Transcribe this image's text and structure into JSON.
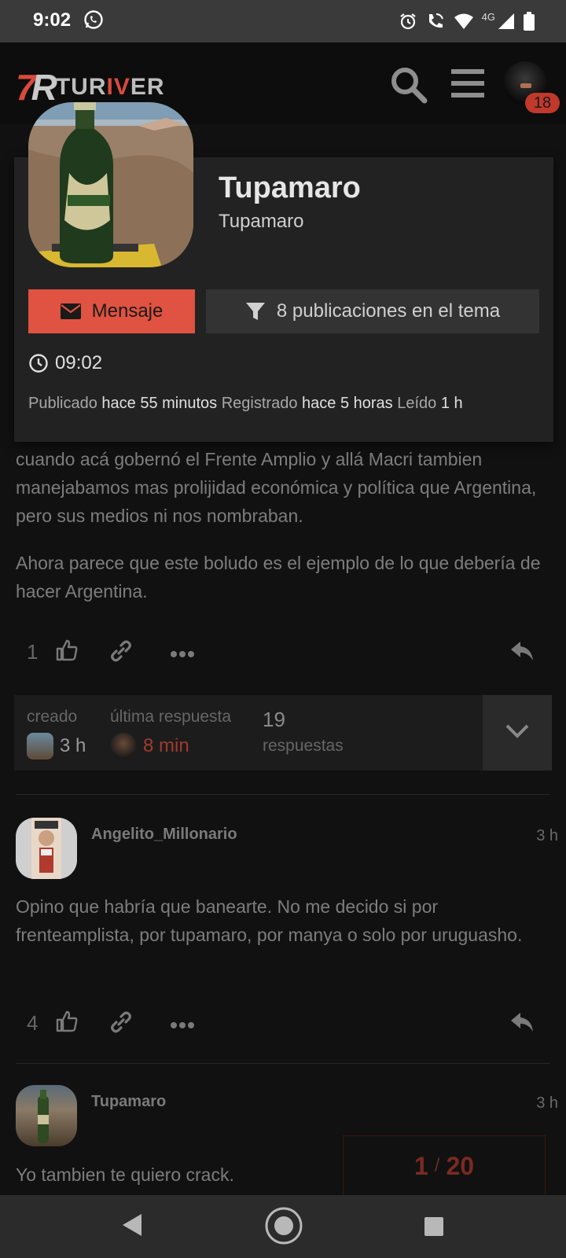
{
  "status_bar": {
    "time": "9:02",
    "network": "4G"
  },
  "header": {
    "logo_mark_a": "7",
    "logo_mark_b": "R",
    "logo_word_a": "TUR",
    "logo_word_b": "IV",
    "logo_word_c": "ER",
    "notification_count": "18"
  },
  "user_card": {
    "name": "Tupamaro",
    "username": "Tupamaro",
    "message_button": "Mensaje",
    "filter_button": "8 publicaciones en el tema",
    "local_time": "09:02",
    "posted_label": "Publicado",
    "posted_value": "hace 55 minutos",
    "registered_label": "Registrado",
    "registered_value": "hace 5 horas",
    "read_label": "Leído",
    "read_value": "1 h"
  },
  "post1": {
    "paragraph1": "cuando acá gobernó el Frente Amplio y allá Macri tambien manejabamos mas prolijidad económica y política que Argentina, pero sus medios ni nos nombraban.",
    "paragraph2": "Ahora parece que este boludo es el ejemplo de lo que debería de hacer Argentina.",
    "likes": "1"
  },
  "topic_map": {
    "created_label": "creado",
    "created_value": "3 h",
    "last_reply_label": "última respuesta",
    "last_reply_value": "8 min",
    "replies_count": "19",
    "replies_label": "respuestas"
  },
  "post2": {
    "username": "Angelito_Millonario",
    "time": "3 h",
    "text": "Opino que habría que banearte. No me decido si por frenteamplista, por tupamaro, por manya o solo por uruguasho.",
    "likes": "4"
  },
  "post3": {
    "username": "Tupamaro",
    "time": "3 h",
    "text": "Yo tambien te quiero crack."
  },
  "progress": {
    "current": "1",
    "separator": "/",
    "total": "20"
  },
  "colors": {
    "accent": "#e05241",
    "background": "#111111",
    "card": "#222222"
  }
}
